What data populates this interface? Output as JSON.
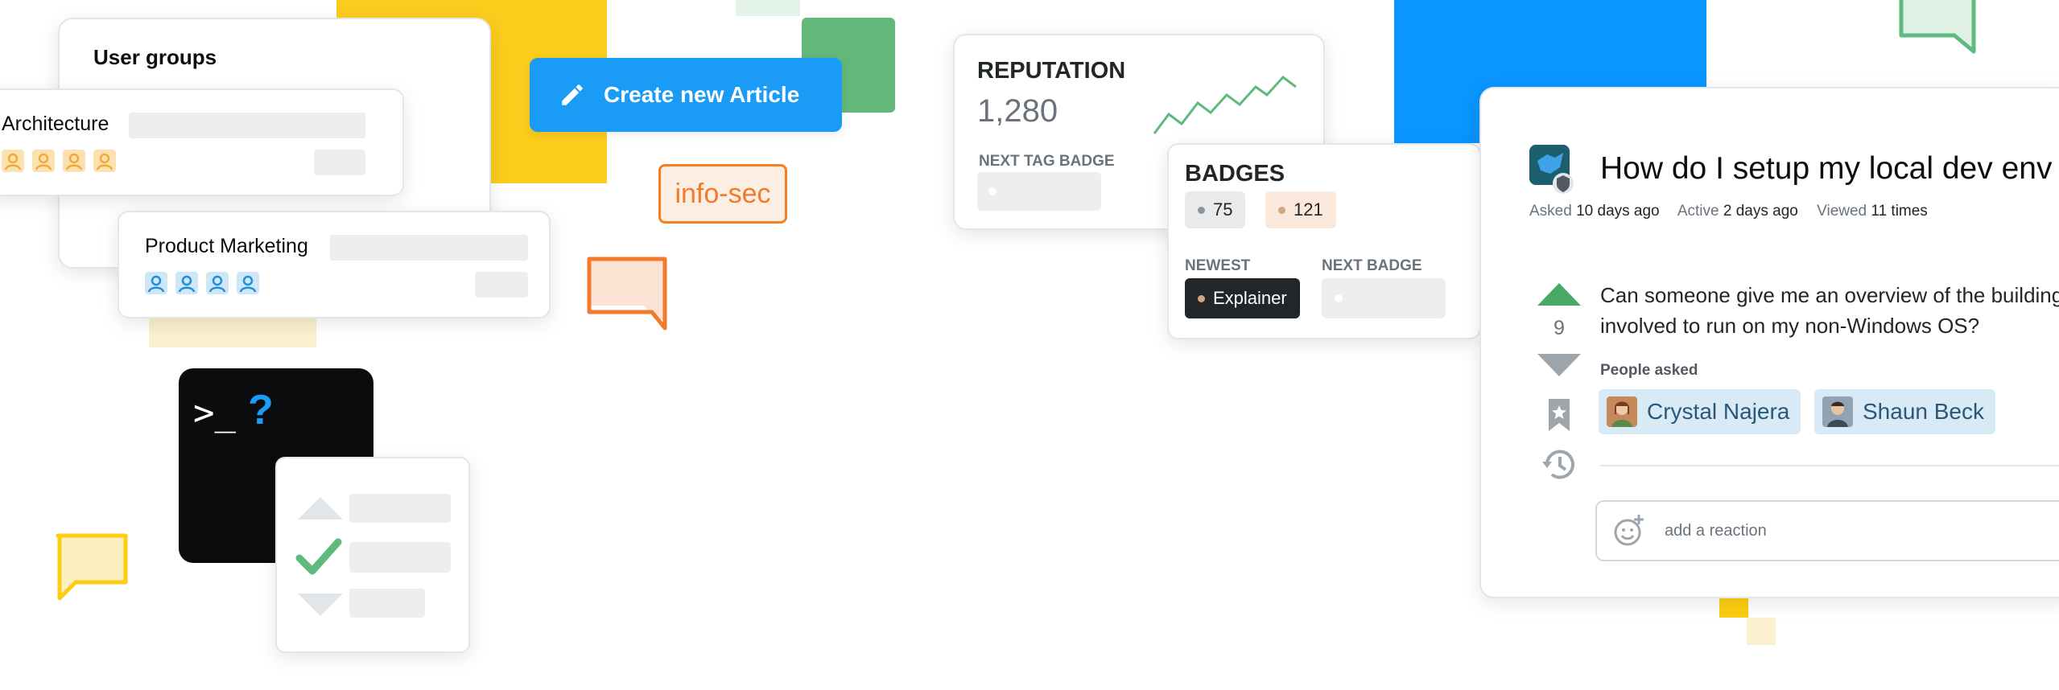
{
  "user_groups": {
    "title": "User groups",
    "groups": [
      {
        "name": "Architecture",
        "member_icon_color": "#f2a93b"
      },
      {
        "name": "Product Marketing",
        "member_icon_color": "#1e90d6"
      }
    ]
  },
  "create_button": {
    "label": "Create new Article",
    "icon": "pencil-icon",
    "color": "#1a9bf5"
  },
  "tag": {
    "label": "info-sec",
    "color": "#f27a2c"
  },
  "terminal": {
    "prompt": ">_",
    "question": "?"
  },
  "reputation": {
    "title": "REPUTATION",
    "value": "1,280",
    "next_tag_label": "NEXT TAG BADGE"
  },
  "badges": {
    "title": "BADGES",
    "silver": "75",
    "bronze": "121",
    "newest_label": "NEWEST",
    "newest_badge": "Explainer",
    "next_label": "NEXT BADGE"
  },
  "question": {
    "title": "How do I setup my local dev env",
    "meta": {
      "asked_label": "Asked",
      "asked_value": "10 days ago",
      "active_label": "Active",
      "active_value": "2 days ago",
      "viewed_label": "Viewed",
      "viewed_value": "11 times"
    },
    "vote_count": "9",
    "body_line1": "Can someone give me an overview of the building",
    "body_line2": "involved to run on my non-Windows OS?",
    "people_asked_label": "People asked",
    "people": [
      "Crystal Najera",
      "Shaun Beck"
    ],
    "reaction_placeholder": "add a reaction"
  },
  "colors": {
    "yellow": "#fccd11",
    "green": "#5eba7d",
    "blue": "#0a95ff",
    "orange": "#f48024"
  }
}
